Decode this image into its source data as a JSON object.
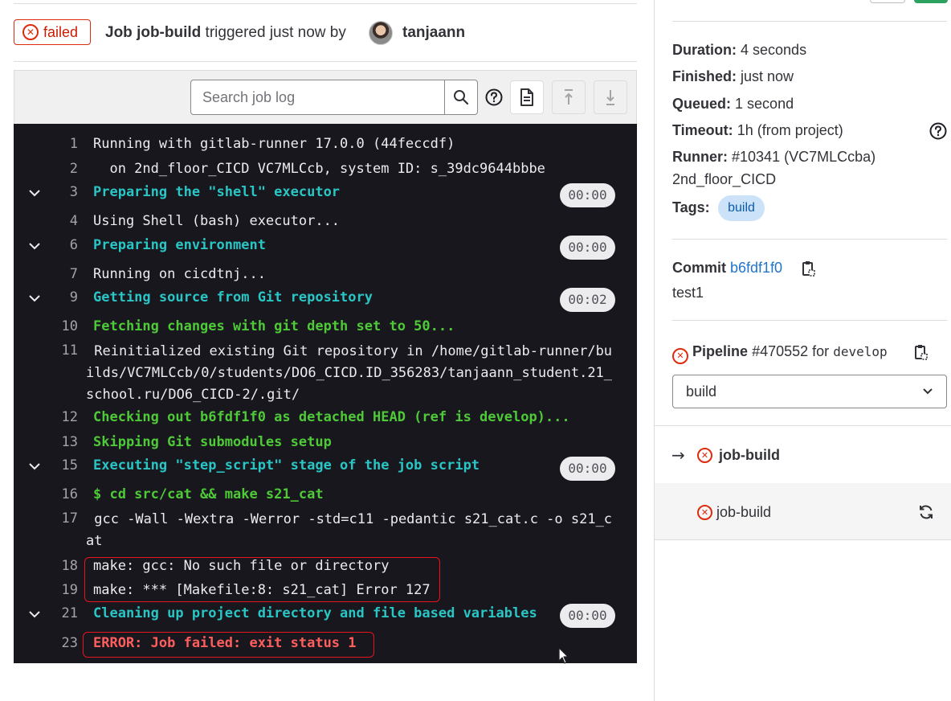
{
  "header": {
    "status": "failed",
    "job_prefix": "Job",
    "job_name": "job-build",
    "triggered_text": "triggered just now by",
    "user": "tanjaann"
  },
  "toolbar": {
    "search_placeholder": "Search job log"
  },
  "log": {
    "lines": [
      {
        "n": "1",
        "text": "Running with gitlab-runner 17.0.0 (44feccdf)"
      },
      {
        "n": "2",
        "text": "  on 2nd_floor_CICD VC7MLCcb, system ID: s_39dc9644bbbe"
      },
      {
        "n": "3",
        "text": "Preparing the \"shell\" executor",
        "dur": "00:00"
      },
      {
        "n": "4",
        "text": "Using Shell (bash) executor..."
      },
      {
        "n": "6",
        "text": "Preparing environment",
        "dur": "00:00"
      },
      {
        "n": "7",
        "text": "Running on cicdtnj..."
      },
      {
        "n": "9",
        "text": "Getting source from Git repository",
        "dur": "00:02"
      },
      {
        "n": "10",
        "text": "Fetching changes with git depth set to 50..."
      },
      {
        "n": "11",
        "text": " Reinitialized existing Git repository in /home/gitlab-runner/builds/VC7MLCcb/0/students/DO6_CICD.ID_356283/tanjaann_student.21_school.ru/DO6_CICD-2/.git/"
      },
      {
        "n": "12",
        "text": "Checking out b6fdf1f0 as detached HEAD (ref is develop)..."
      },
      {
        "n": "13",
        "text": "Skipping Git submodules setup"
      },
      {
        "n": "15",
        "text": "Executing \"step_script\" stage of the job script",
        "dur": "00:00"
      },
      {
        "n": "16",
        "text": "$ cd src/cat && make s21_cat"
      },
      {
        "n": "17",
        "text": " gcc -Wall -Wextra -Werror -std=c11 -pedantic s21_cat.c -o s21_cat"
      },
      {
        "n": "18",
        "text": "make: gcc: No such file or directory"
      },
      {
        "n": "19",
        "text": "make: *** [Makefile:8: s21_cat] Error 127"
      },
      {
        "n": "21",
        "text": "Cleaning up project directory and file based variables",
        "dur": "00:00"
      },
      {
        "n": "23",
        "text": "ERROR: Job failed: exit status 1"
      }
    ]
  },
  "sidebar": {
    "duration_label": "Duration:",
    "duration_value": "4 seconds",
    "finished_label": "Finished:",
    "finished_value": "just now",
    "queued_label": "Queued:",
    "queued_value": "1 second",
    "timeout_label": "Timeout:",
    "timeout_value": "1h (from project)",
    "runner_label": "Runner:",
    "runner_value": "#10341 (VC7MLCcba)",
    "runner_name": "2nd_floor_CICD",
    "tags_label": "Tags:",
    "tag": "build",
    "commit_label": "Commit",
    "commit_sha": "b6fdf1f0",
    "commit_title": "test1",
    "pipeline_label": "Pipeline",
    "pipeline_id": "#470552",
    "pipeline_for": "for",
    "pipeline_ref": "develop",
    "stage_select": "build",
    "current_job": "job-build",
    "job_list_item": "job-build"
  },
  "colors": {
    "failed": "#dd2b0e",
    "section_header": "#2ac5c5",
    "success_text": "#4ec938",
    "error_text": "#ff5e5e",
    "log_background": "#18171d",
    "link": "#1f75cb"
  }
}
